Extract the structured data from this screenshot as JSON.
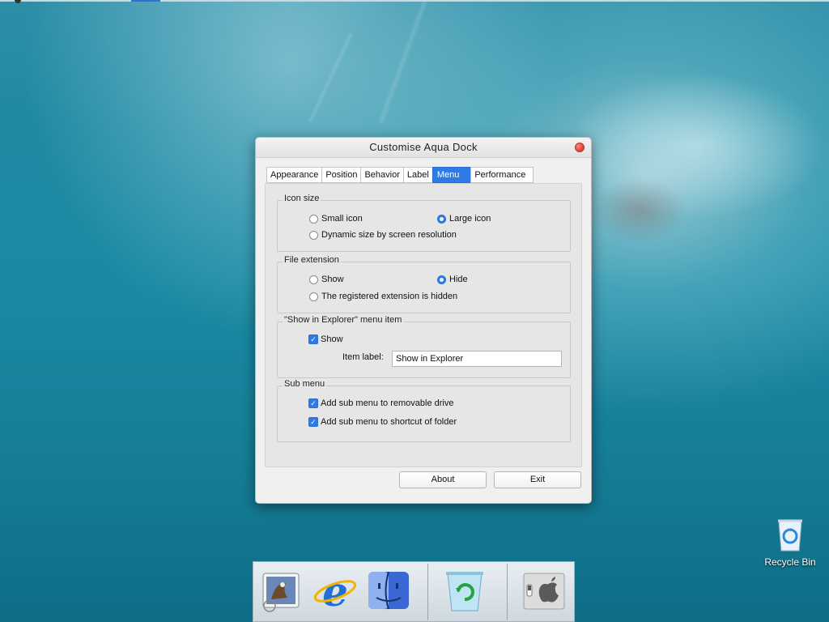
{
  "dialog": {
    "title": "Customise Aqua Dock",
    "tabs": [
      "Appearance",
      "Position",
      "Behavior",
      "Label",
      "Menu",
      "Performance"
    ],
    "active_tab": "Menu",
    "icon_size": {
      "label": "Icon size",
      "small": "Small icon",
      "large": "Large icon",
      "dynamic": "Dynamic size by screen resolution",
      "selected": "Large icon"
    },
    "file_extension": {
      "label": "File extension",
      "show": "Show",
      "hide": "Hide",
      "registered": "The registered extension is hidden",
      "selected": "Hide"
    },
    "show_in_explorer": {
      "label": "\"Show in Explorer\" menu item",
      "show": "Show",
      "show_checked": true,
      "item_label_caption": "Item label:",
      "item_label_value": "Show in Explorer"
    },
    "sub_menu": {
      "label": "Sub menu",
      "removable": "Add sub menu to removable drive",
      "removable_checked": true,
      "shortcut": "Add sub menu to shortcut of folder",
      "shortcut_checked": true
    },
    "buttons": {
      "about": "About",
      "exit": "Exit"
    }
  },
  "desktop": {
    "recycle_bin_label": "Recycle Bin"
  },
  "dock": {
    "items": [
      "mail-icon",
      "internet-explorer-icon",
      "finder-icon",
      "recycle-bin-icon",
      "system-preferences-icon"
    ]
  },
  "colors": {
    "accent": "#2f7be6",
    "close": "#e0443e"
  }
}
